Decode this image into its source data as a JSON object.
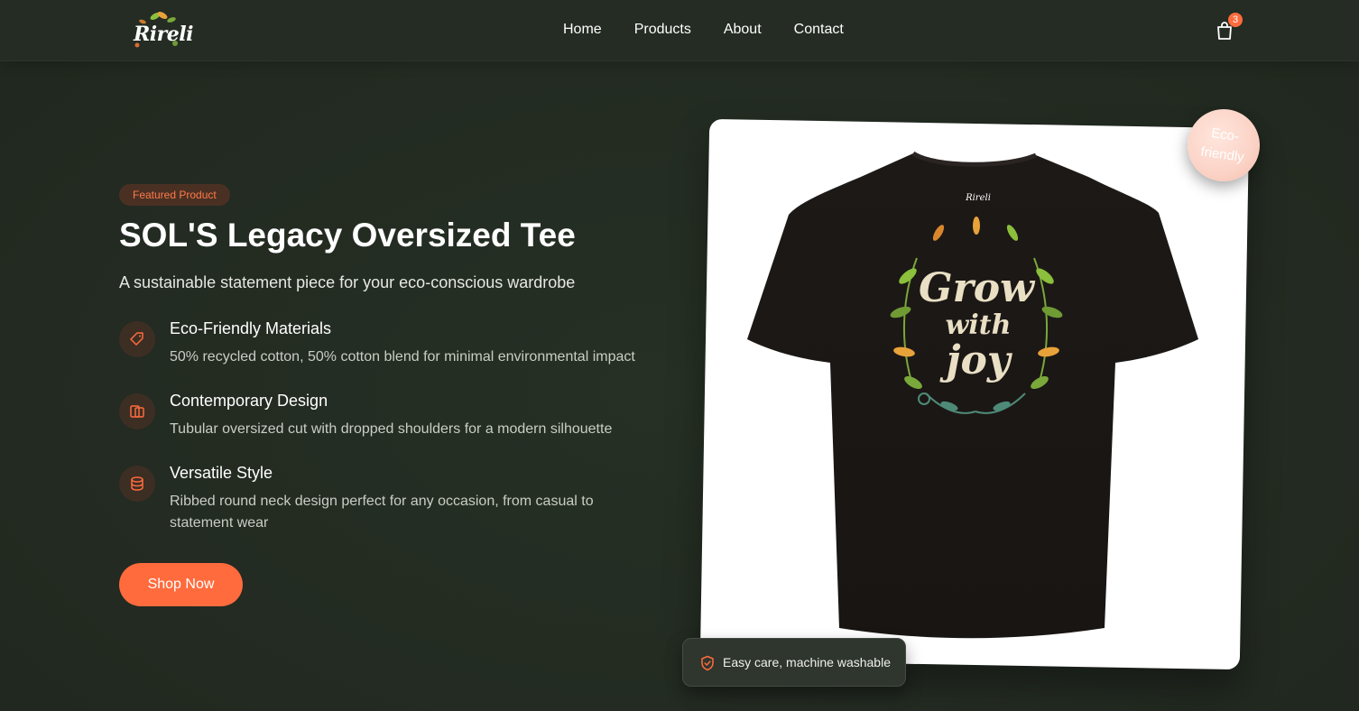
{
  "brand": {
    "logo_text": "Rireli"
  },
  "nav": {
    "links": [
      {
        "label": "Home"
      },
      {
        "label": "Products"
      },
      {
        "label": "About"
      },
      {
        "label": "Contact"
      }
    ],
    "cart_count": "3"
  },
  "hero": {
    "badge": "Featured Product",
    "title": "SOL'S Legacy Oversized Tee",
    "subtitle": "A sustainable statement piece for your eco-conscious wardrobe",
    "features": [
      {
        "icon": "tag-icon",
        "title": "Eco-Friendly Materials",
        "desc": "50% recycled cotton, 50% cotton blend for minimal environmental impact"
      },
      {
        "icon": "layers-icon",
        "title": "Contemporary Design",
        "desc": "Tubular oversized cut with dropped shoulders for a modern silhouette"
      },
      {
        "icon": "cylinder-icon",
        "title": "Versatile Style",
        "desc": "Ribbed round neck design perfect for any occasion, from casual to statement wear"
      }
    ],
    "cta": "Shop Now"
  },
  "product": {
    "eco_badge": "Eco-friendly",
    "shirt_print_line1": "Grow",
    "shirt_print_line2": "with",
    "shirt_print_line3": "joy",
    "shirt_logo": "Rireli",
    "care_note": "Easy care, machine washable"
  },
  "colors": {
    "background": "#232b22",
    "accent": "#ff6b3d",
    "shirt": "#1f1b19"
  }
}
